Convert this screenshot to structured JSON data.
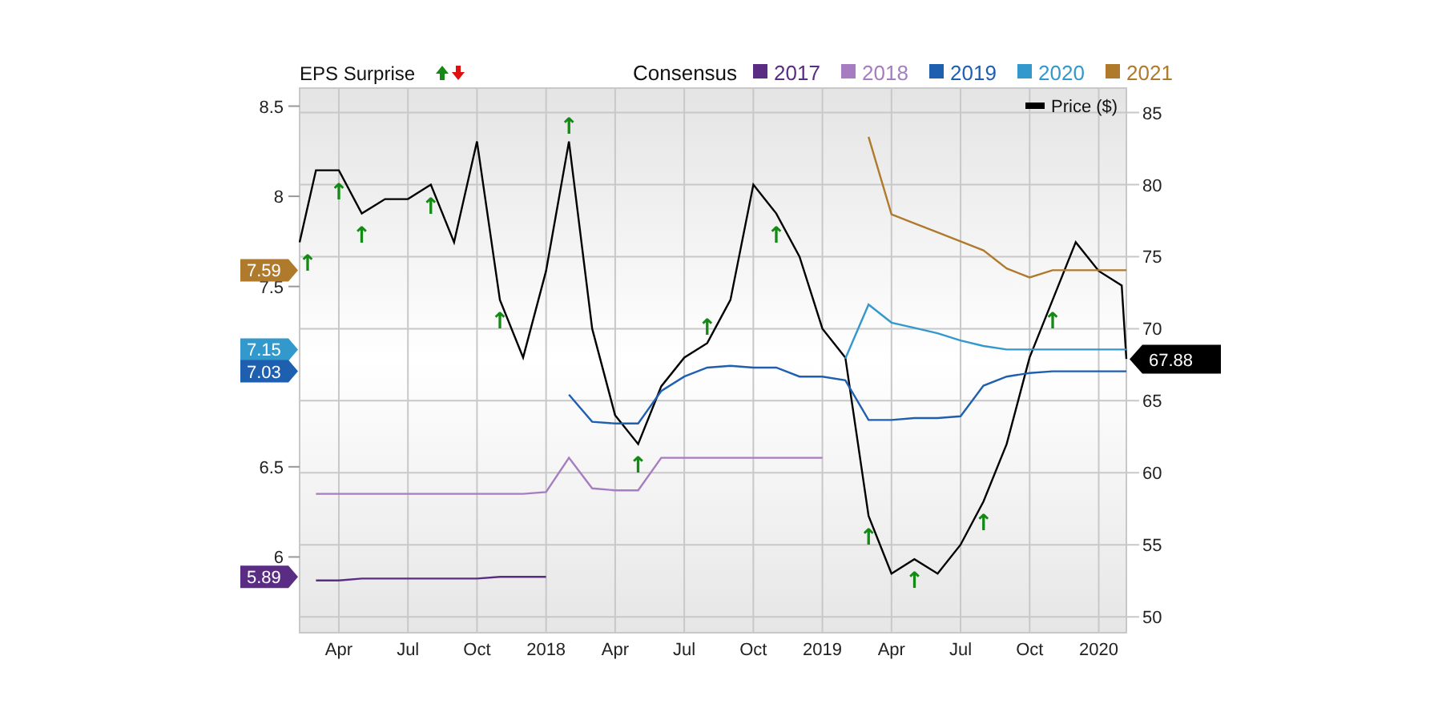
{
  "eps_surprise": {
    "label": "EPS Surprise"
  },
  "price_chart": {
    "chart_data": {
      "type": "line",
      "x": [
        2017.108,
        2017.167,
        2017.25,
        2017.333,
        2017.417,
        2017.5,
        2017.583,
        2017.667,
        2017.75,
        2017.833,
        2017.917,
        2018,
        2018.083,
        2018.167,
        2018.25,
        2018.333,
        2018.417,
        2018.5,
        2018.583,
        2018.667,
        2018.75,
        2018.833,
        2018.917,
        2019,
        2019.083,
        2019.167,
        2019.25,
        2019.333,
        2019.417,
        2019.5,
        2019.583,
        2019.667,
        2019.75,
        2019.833,
        2019.917,
        2020,
        2020.083,
        2020.1
      ],
      "xlim": [
        2017.108,
        2020.1
      ],
      "ylim": [
        48.9,
        86.7
      ],
      "xticks": [
        {
          "value": 2017.25,
          "label": "Apr"
        },
        {
          "value": 2017.5,
          "label": "Jul"
        },
        {
          "value": 2017.75,
          "label": "Oct"
        },
        {
          "value": 2018,
          "label": "2018"
        },
        {
          "value": 2018.25,
          "label": "Apr"
        },
        {
          "value": 2018.5,
          "label": "Jul"
        },
        {
          "value": 2018.75,
          "label": "Oct"
        },
        {
          "value": 2019,
          "label": "2019"
        },
        {
          "value": 2019.25,
          "label": "Apr"
        },
        {
          "value": 2019.5,
          "label": "Jul"
        },
        {
          "value": 2019.75,
          "label": "Oct"
        },
        {
          "value": 2020,
          "label": "2020"
        }
      ],
      "yticks": [
        50,
        55,
        60,
        65,
        70,
        75,
        80,
        85
      ],
      "series": [
        {
          "name": "Price ($)",
          "color": "#000000",
          "values": [
            76,
            81,
            81,
            78,
            79,
            79,
            80,
            76,
            83,
            72,
            68,
            74,
            83,
            70,
            64,
            62,
            66,
            68,
            69,
            72,
            80,
            78,
            75,
            70,
            68,
            57,
            53,
            54,
            53,
            55,
            58,
            62,
            68,
            72,
            76,
            74,
            73,
            67.9
          ]
        }
      ],
      "annotations": [
        {
          "x": 2017.108,
          "y": 76,
          "text": "↑"
        },
        {
          "x": 2017.25,
          "y": 81,
          "text": "↑"
        },
        {
          "x": 2017.333,
          "y": 78,
          "text": "↑"
        },
        {
          "x": 2017.583,
          "y": 80,
          "text": "↑"
        },
        {
          "x": 2017.833,
          "y": 72,
          "text": "↑"
        },
        {
          "x": 2018.083,
          "y": 83,
          "text": "↑"
        },
        {
          "x": 2018.333,
          "y": 62,
          "text": "↑"
        },
        {
          "x": 2018.583,
          "y": 69,
          "text": "↑"
        },
        {
          "x": 2018.833,
          "y": 78,
          "text": "↑"
        },
        {
          "x": 2019.167,
          "y": 57,
          "text": "↑"
        },
        {
          "x": 2019.333,
          "y": 54,
          "text": "↑"
        },
        {
          "x": 2019.583,
          "y": 58,
          "text": "↑"
        },
        {
          "x": 2019.833,
          "y": 72,
          "text": "↑"
        }
      ]
    },
    "price_tag": {
      "label": "67.88",
      "color": "#000000"
    }
  },
  "consensus_chart": {
    "chart_data": {
      "type": "line",
      "title": "Consensus",
      "legend": "top",
      "x": [
        2017.167,
        2017.25,
        2017.333,
        2017.417,
        2017.5,
        2017.583,
        2017.667,
        2017.75,
        2017.833,
        2017.917,
        2018,
        2018.083,
        2018.167,
        2018.25,
        2018.333,
        2018.417,
        2018.5,
        2018.583,
        2018.667,
        2018.75,
        2018.833,
        2018.917,
        2019,
        2019.083,
        2019.167,
        2019.25,
        2019.333,
        2019.417,
        2019.5,
        2019.583,
        2019.667,
        2019.75,
        2019.833,
        2019.917,
        2020,
        2020.083,
        2020.1
      ],
      "xlim": [
        2017.108,
        2020.1
      ],
      "ylim": [
        5.58,
        8.6
      ],
      "yticks": [
        6,
        6.5,
        7.5,
        8,
        8.5
      ],
      "series": [
        {
          "name": "2017",
          "color": "#5b2c83",
          "values": [
            5.87,
            5.87,
            5.88,
            5.88,
            5.88,
            5.88,
            5.88,
            5.88,
            5.89,
            5.89,
            5.89,
            null,
            null,
            null,
            null,
            null,
            null,
            null,
            null,
            null,
            null,
            null,
            null,
            null,
            null,
            null,
            null,
            null,
            null,
            null,
            null,
            null,
            null,
            null,
            null,
            null,
            null
          ]
        },
        {
          "name": "2018",
          "color": "#a67dc0",
          "values": [
            6.35,
            6.35,
            6.35,
            6.35,
            6.35,
            6.35,
            6.35,
            6.35,
            6.35,
            6.35,
            6.36,
            6.55,
            6.38,
            6.37,
            6.37,
            6.55,
            6.55,
            6.55,
            6.55,
            6.55,
            6.55,
            6.55,
            6.55,
            null,
            null,
            null,
            null,
            null,
            null,
            null,
            null,
            null,
            null,
            null,
            null,
            null,
            null
          ]
        },
        {
          "name": "2019",
          "color": "#1f5fb0",
          "values": [
            null,
            null,
            null,
            null,
            null,
            null,
            null,
            null,
            null,
            null,
            null,
            6.9,
            6.75,
            6.74,
            6.74,
            6.92,
            7.0,
            7.05,
            7.06,
            7.05,
            7.05,
            7.0,
            7.0,
            6.98,
            6.76,
            6.76,
            6.77,
            6.77,
            6.78,
            6.95,
            7.0,
            7.02,
            7.03,
            7.03,
            7.03,
            7.03,
            7.03
          ]
        },
        {
          "name": "2020",
          "color": "#3399cc",
          "values": [
            null,
            null,
            null,
            null,
            null,
            null,
            null,
            null,
            null,
            null,
            null,
            null,
            null,
            null,
            null,
            null,
            null,
            null,
            null,
            null,
            null,
            null,
            null,
            7.1,
            7.4,
            7.3,
            7.27,
            7.24,
            7.2,
            7.17,
            7.15,
            7.15,
            7.15,
            7.15,
            7.15,
            7.15,
            7.15
          ]
        },
        {
          "name": "2021",
          "color": "#b07a2c",
          "values": [
            null,
            null,
            null,
            null,
            null,
            null,
            null,
            null,
            null,
            null,
            null,
            null,
            null,
            null,
            null,
            null,
            null,
            null,
            null,
            null,
            null,
            null,
            null,
            null,
            8.33,
            7.9,
            7.85,
            7.8,
            7.75,
            7.7,
            7.6,
            7.55,
            7.59,
            7.59,
            7.59,
            7.59,
            7.59
          ]
        }
      ]
    },
    "tags": [
      {
        "label": "7.59",
        "color": "#b07a2c"
      },
      {
        "label": "7.15",
        "color": "#3399cc"
      },
      {
        "label": "7.03",
        "color": "#1f5fb0"
      },
      {
        "label": "5.89",
        "color": "#5b2c83"
      }
    ]
  }
}
